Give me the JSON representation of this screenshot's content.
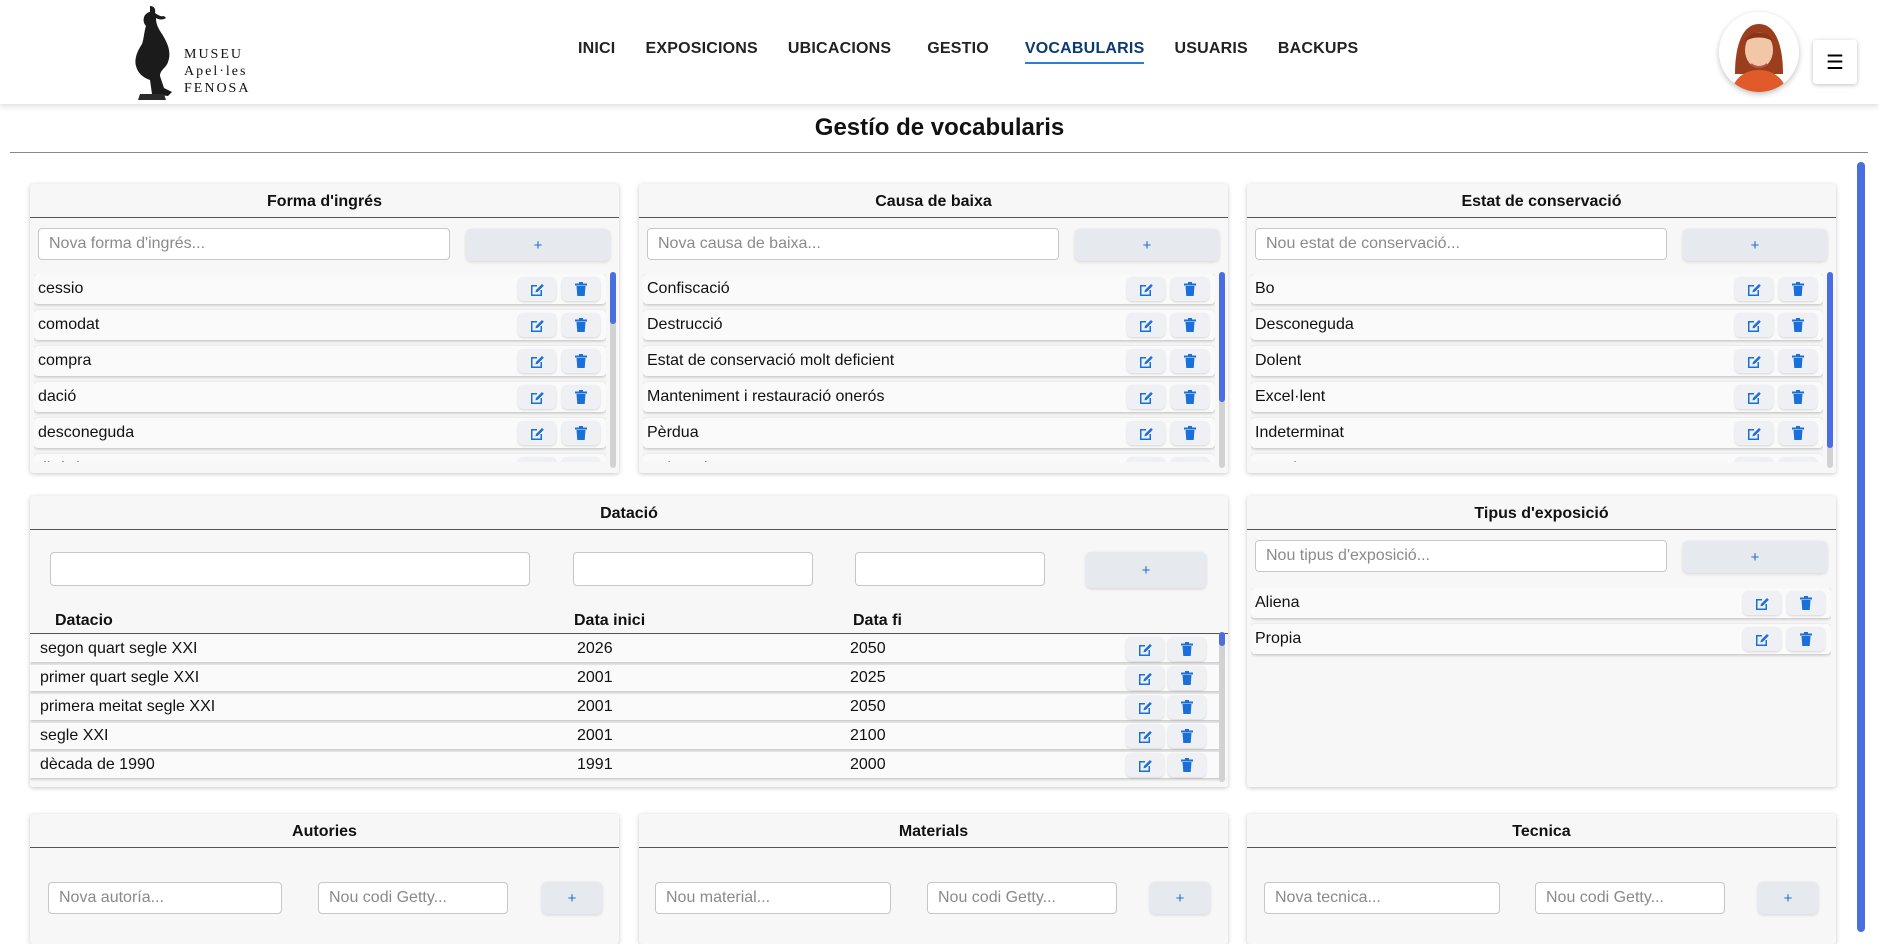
{
  "header": {
    "logo": {
      "line1": "MUSEU",
      "line2": "Apel·les",
      "line3": "FENOSA"
    },
    "nav": [
      {
        "label": "INICI"
      },
      {
        "label": "EXPOSICIONS"
      },
      {
        "label": "UBICACIONS"
      },
      {
        "label": "GESTIO"
      },
      {
        "label": "VOCABULARIS",
        "active": true
      },
      {
        "label": "USUARIS"
      },
      {
        "label": "BACKUPS"
      }
    ],
    "menu_icon": "☰"
  },
  "page": {
    "title": "Gestío de vocabularis"
  },
  "panels": {
    "forma": {
      "title": "Forma d'ingrés",
      "placeholder": "Nova forma d'ingrés...",
      "add_label": "+",
      "items": [
        "cessio",
        "comodat",
        "compra",
        "dació",
        "desconeguda",
        "dipòsit"
      ]
    },
    "causa": {
      "title": "Causa de baixa",
      "placeholder": "Nova causa de baixa...",
      "add_label": "+",
      "items": [
        "Confiscació",
        "Destrucció",
        "Estat de conservació molt deficient",
        "Manteniment i restauració onerós",
        "Pèrdua",
        "Robatori"
      ]
    },
    "estat": {
      "title": "Estat de conservació",
      "placeholder": "Nou estat de conservació...",
      "add_label": "+",
      "items": [
        "Bo",
        "Desconeguda",
        "Dolent",
        "Excel·lent",
        "Indeterminat",
        "Regular"
      ]
    },
    "datacio": {
      "title": "Datació",
      "add_label": "+",
      "columns": [
        "Datacio",
        "Data inici",
        "Data fi"
      ],
      "rows": [
        {
          "datacio": "segon quart segle XXI",
          "inici": "2026",
          "fi": "2050"
        },
        {
          "datacio": "primer quart segle XXI",
          "inici": "2001",
          "fi": "2025"
        },
        {
          "datacio": "primera meitat segle XXI",
          "inici": "2001",
          "fi": "2050"
        },
        {
          "datacio": "segle XXI",
          "inici": "2001",
          "fi": "2100"
        },
        {
          "datacio": "dècada de 1990",
          "inici": "1991",
          "fi": "2000"
        }
      ]
    },
    "tipus": {
      "title": "Tipus d'exposició",
      "placeholder": "Nou tipus d'exposició...",
      "add_label": "+",
      "items": [
        "Aliena",
        "Propia"
      ]
    },
    "autories": {
      "title": "Autories",
      "placeholder": "Nova autoría...",
      "code_placeholder": "Nou codi Getty...",
      "add_label": "+"
    },
    "materials": {
      "title": "Materials",
      "placeholder": "Nou material...",
      "code_placeholder": "Nou codi Getty...",
      "add_label": "+"
    },
    "tecnica": {
      "title": "Tecnica",
      "placeholder": "Nova tecnica...",
      "code_placeholder": "Nou codi Getty...",
      "add_label": "+"
    }
  },
  "colors": {
    "accent": "#1a6fd8",
    "scroll": "#4a6ee0",
    "active_nav": "#2a7fd4"
  },
  "icons": {
    "edit": "edit-icon",
    "delete": "trash-icon"
  }
}
